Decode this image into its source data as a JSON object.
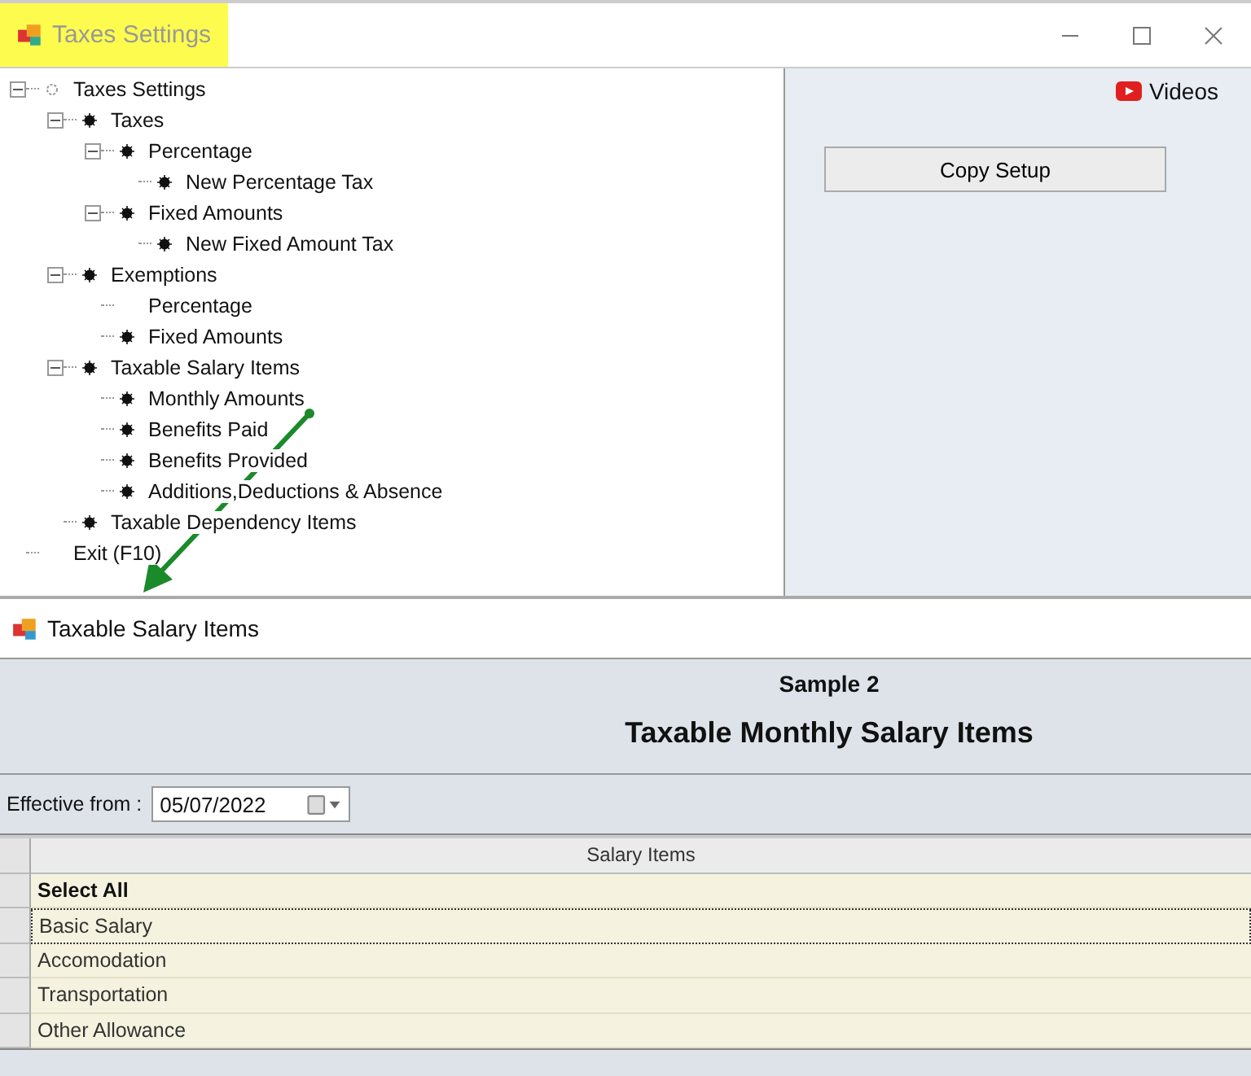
{
  "top_window": {
    "title": "Taxes Settings",
    "highlighted": true
  },
  "tree": [
    {
      "label": "Taxes Settings",
      "kind": "root",
      "expanded": true,
      "children": [
        {
          "label": "Taxes",
          "kind": "item",
          "expanded": true,
          "children": [
            {
              "label": "Percentage",
              "kind": "item",
              "expanded": true,
              "children": [
                {
                  "label": "New Percentage Tax",
                  "kind": "item"
                }
              ]
            },
            {
              "label": "Fixed Amounts",
              "kind": "item",
              "expanded": true,
              "children": [
                {
                  "label": "New Fixed Amount Tax",
                  "kind": "item"
                }
              ]
            }
          ]
        },
        {
          "label": "Exemptions",
          "kind": "item",
          "expanded": true,
          "children": [
            {
              "label": "Percentage",
              "kind": "plain"
            },
            {
              "label": "Fixed Amounts",
              "kind": "item"
            }
          ]
        },
        {
          "label": "Taxable Salary Items",
          "kind": "item",
          "expanded": true,
          "children": [
            {
              "label": "Monthly Amounts",
              "kind": "item"
            },
            {
              "label": "Benefits Paid",
              "kind": "item"
            },
            {
              "label": "Benefits Provided",
              "kind": "item"
            },
            {
              "label": "Additions,Deductions & Absence",
              "kind": "item"
            }
          ]
        },
        {
          "label": "Taxable Dependency Items",
          "kind": "item"
        }
      ]
    },
    {
      "label": "Exit (F10)",
      "kind": "plain"
    }
  ],
  "side_panel": {
    "videos_link": "Videos",
    "copy_button": "Copy Setup"
  },
  "bottom_window": {
    "title": "Taxable Salary Items",
    "company": "Sample 2",
    "heading": "Taxable Monthly Salary Items",
    "effective_label": "Effective from :",
    "effective_date": "05/07/2022",
    "grid": {
      "columns": [
        "Salary Items"
      ],
      "rows": [
        {
          "label": "Select All",
          "kind": "select_all",
          "focused": false
        },
        {
          "label": "Basic Salary",
          "kind": "item",
          "focused": true
        },
        {
          "label": "Accomodation",
          "kind": "item",
          "focused": false
        },
        {
          "label": "Transportation",
          "kind": "item",
          "focused": false
        },
        {
          "label": "Other Allowance",
          "kind": "item",
          "focused": false
        }
      ]
    }
  }
}
